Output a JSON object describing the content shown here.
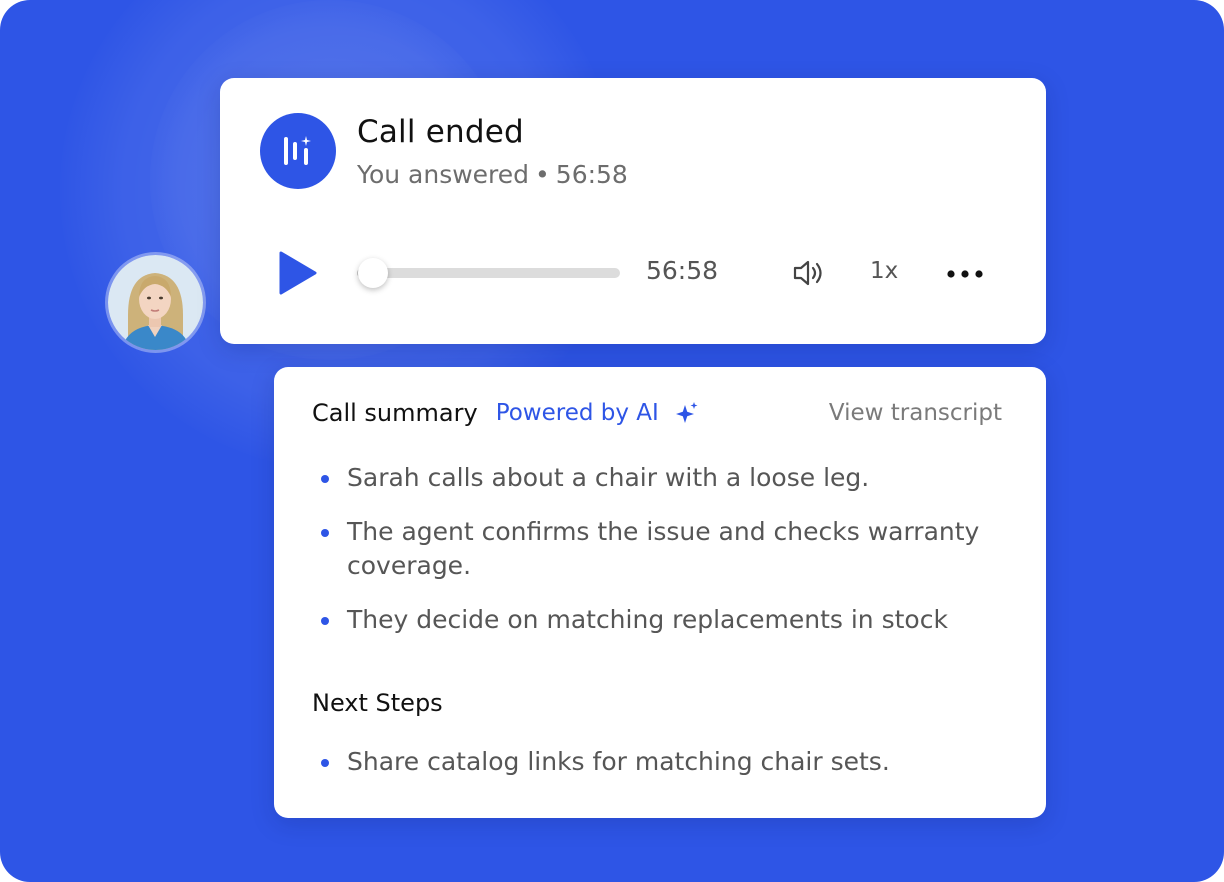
{
  "theme": {
    "background": "#2e55e6",
    "accent": "#2e55e6",
    "card": "#ffffff"
  },
  "call": {
    "icon": "voice-wave-ai-icon",
    "title": "Call ended",
    "answered": "You answered",
    "separator": "•",
    "call_duration": "56:58"
  },
  "player": {
    "play_icon": "play-icon",
    "progress": 0.06,
    "time": "56:58",
    "volume_icon": "volume-icon",
    "speed": "1x",
    "more_icon": "more-horizontal-icon"
  },
  "caller": {
    "avatar": "caller-avatar-photo"
  },
  "summary": {
    "title": "Call summary",
    "powered_by": "Powered by AI",
    "sparkle_icon": "sparkle-icon",
    "view_transcript": "View transcript",
    "points": [
      "Sarah calls about a chair with a loose leg.",
      "The agent confirms the issue and checks warranty coverage.",
      "They decide on matching replacements in stock"
    ],
    "next_steps_title": "Next Steps",
    "next_steps": [
      "Share catalog links for matching chair sets."
    ]
  }
}
